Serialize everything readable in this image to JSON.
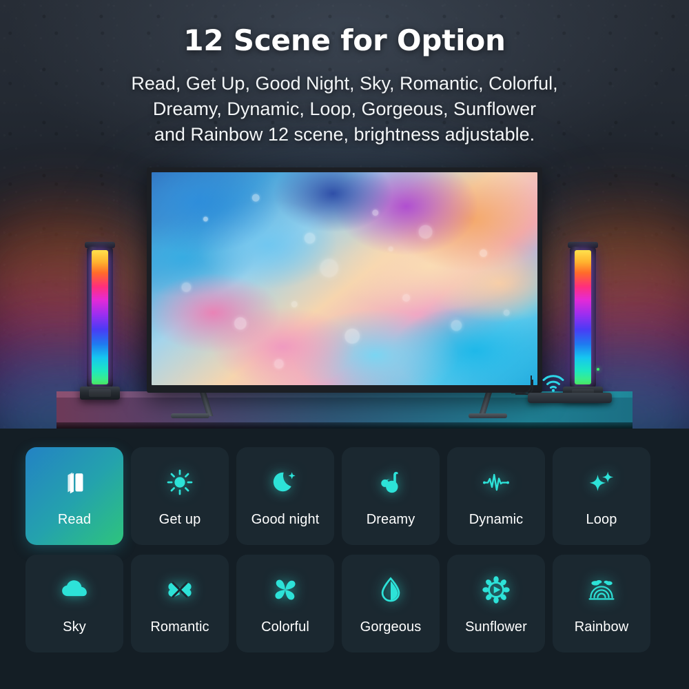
{
  "header": {
    "title": "12 Scene for Option",
    "subtitle_lines": [
      "Read, Get Up, Good Night, Sky, Romantic, Colorful,",
      "Dreamy, Dynamic, Loop, Gorgeous, Sunflower",
      "and Rainbow 12 scene, brightness adjustable."
    ]
  },
  "hero": {
    "tv_alt": "television-display",
    "wifi_icon": "wifi-icon",
    "left_bar": "rgb-light-bar-left",
    "right_bar": "rgb-light-bar-right",
    "soundbar": "soundbar-device",
    "led_colors": [
      "#ffe14d",
      "#ffb22e",
      "#ff6a2a",
      "#ff2f7a",
      "#e42ad6",
      "#9b2ef0",
      "#4a3bf5",
      "#1f7af0",
      "#16c6f0",
      "#1ee8c0",
      "#4df06a"
    ]
  },
  "colors": {
    "panel_bg": "#141e25",
    "tile_bg": "#1b2830",
    "tile_active_from": "#2382c4",
    "tile_active_to": "#2ec47c",
    "icon_accent": "#2de2d8",
    "wifi_accent": "#2dd6e8",
    "label": "#ffffff"
  },
  "scenes": {
    "count": 12,
    "items": [
      {
        "label": "Read",
        "icon": "book-icon",
        "active": true
      },
      {
        "label": "Get up",
        "icon": "sun-icon",
        "active": false
      },
      {
        "label": "Good night",
        "icon": "moon-icon",
        "active": false
      },
      {
        "label": "Dreamy",
        "icon": "music-note-icon",
        "active": false
      },
      {
        "label": "Dynamic",
        "icon": "waveform-icon",
        "active": false
      },
      {
        "label": "Loop",
        "icon": "sparkles-icon",
        "active": false
      },
      {
        "label": "Sky",
        "icon": "cloud-icon",
        "active": false
      },
      {
        "label": "Romantic",
        "icon": "clover-icon",
        "active": false
      },
      {
        "label": "Colorful",
        "icon": "pinwheel-icon",
        "active": false
      },
      {
        "label": "Gorgeous",
        "icon": "water-drop-icon",
        "active": false
      },
      {
        "label": "Sunflower",
        "icon": "sunflower-icon",
        "active": false
      },
      {
        "label": "Rainbow",
        "icon": "rainbow-icon",
        "active": false
      }
    ]
  }
}
